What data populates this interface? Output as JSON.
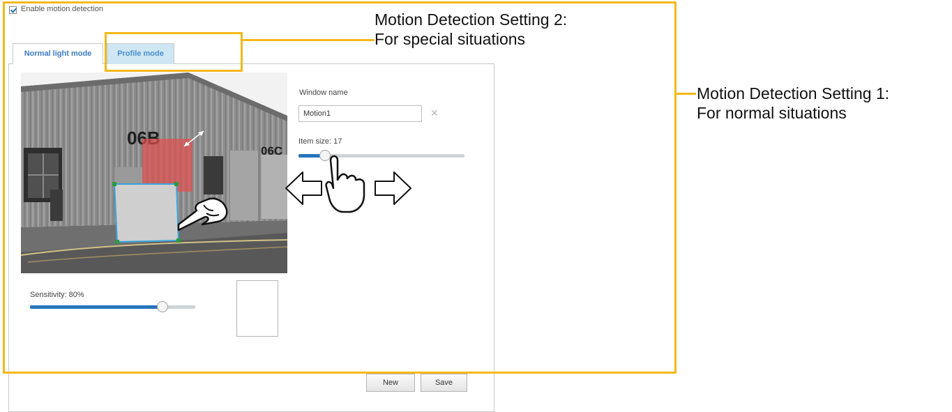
{
  "motion": {
    "enable_label": "Enable motion detection",
    "enabled": true
  },
  "tabs": [
    {
      "label": "Normal light mode",
      "active": true
    },
    {
      "label": "Profile mode",
      "active": false
    }
  ],
  "camera": {
    "sign_left": "06B",
    "sign_right": "06C"
  },
  "window": {
    "name_label": "Window name",
    "name_value": "Motion1",
    "item_size_label": "Item size: 17",
    "item_size_value": 17
  },
  "sensitivity": {
    "label": "Sensitivity: 80%",
    "percent": 80
  },
  "buttons": {
    "new_label": "New",
    "save_label": "Save"
  },
  "callouts": {
    "setting2_line1": "Motion Detection Setting 2:",
    "setting2_line2": "For special situations",
    "setting1_line1": "Motion Detection Setting 1:",
    "setting1_line2": "For normal situations"
  },
  "colors": {
    "highlight": "#f5b81a",
    "accent": "#2774bd",
    "motion_window_active": "#e05050",
    "motion_window_selected": "#cccccc"
  }
}
